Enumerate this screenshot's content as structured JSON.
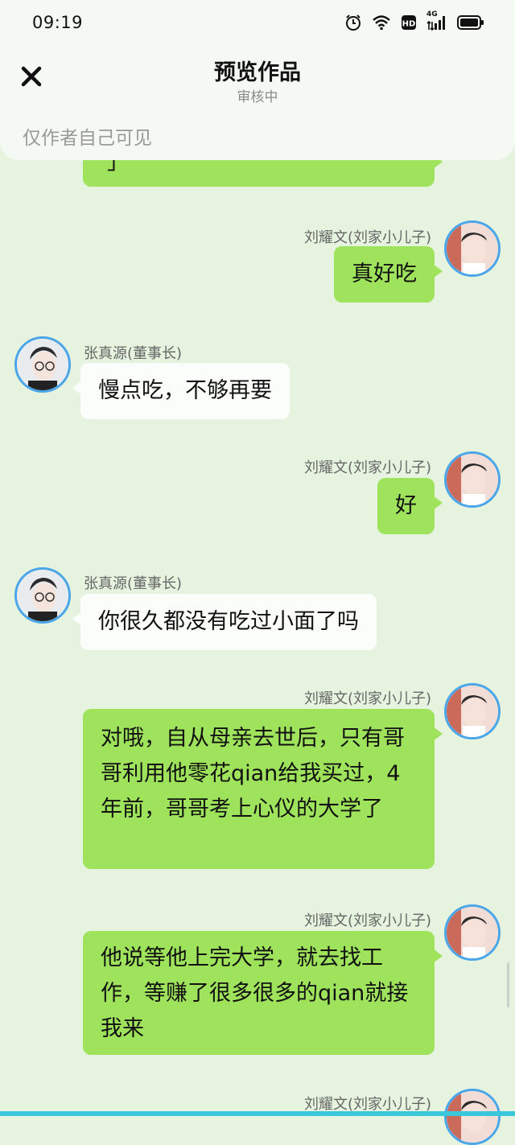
{
  "status": {
    "time": "09:19",
    "network": "4G"
  },
  "header": {
    "title": "预览作品",
    "subtitle": "审核中"
  },
  "visibility": "仅作者自己可见",
  "people": {
    "right": "刘耀文(刘家小儿子)",
    "left": "张真源(董事长)"
  },
  "messages": [
    {
      "side": "right",
      "text": "真好吃"
    },
    {
      "side": "left",
      "text": "慢点吃，不够再要"
    },
    {
      "side": "right",
      "text": "好"
    },
    {
      "side": "left",
      "text": "你很久都没有吃过小面了吗"
    },
    {
      "side": "right",
      "text": "对哦，自从母亲去世后，只有哥哥利用他零花qian给我买过，4年前，哥哥考上心仪的大学了"
    },
    {
      "side": "right",
      "text": "他说等他上完大学，就去找工作，等赚了很多很多的qian就接我来"
    }
  ],
  "partial_top_text": "」"
}
